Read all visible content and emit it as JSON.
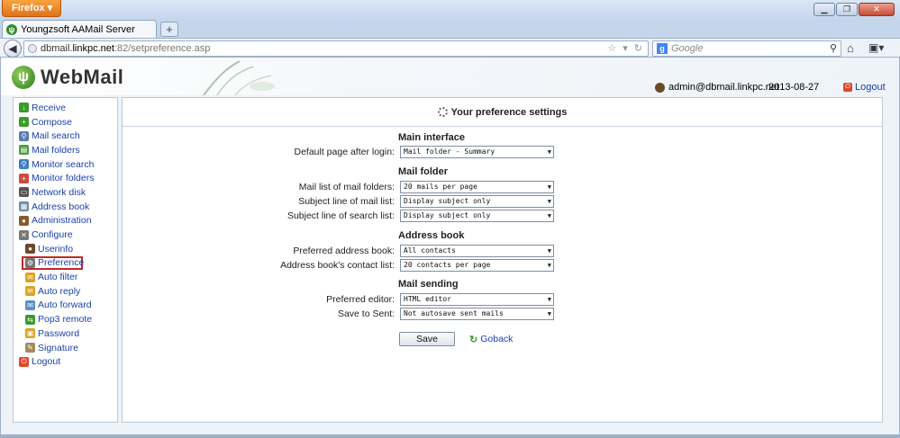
{
  "browser": {
    "menu_label": "Firefox ▾",
    "tab_title": "Youngzsoft AAMail Server",
    "new_tab": "+",
    "url_host_prefix": "dbmail.",
    "url_host_main": "linkpc.net",
    "url_port_path": ":82/setpreference.asp",
    "search_placeholder": "Google",
    "win_minimize": "▁",
    "win_maximize": "❐",
    "win_close": "✕"
  },
  "header": {
    "logo_text": "WebMail",
    "user": "admin@dbmail.linkpc.net",
    "date": "2013-08-27",
    "logout": "Logout"
  },
  "sidebar": {
    "items": [
      {
        "label": "Receive",
        "icon": "receive-icon",
        "color": "#3a9b2a"
      },
      {
        "label": "Compose",
        "icon": "compose-icon",
        "color": "#3a9b2a"
      },
      {
        "label": "Mail search",
        "icon": "search-icon",
        "color": "#5a7fb0"
      },
      {
        "label": "Mail folders",
        "icon": "folders-icon",
        "color": "#4c9a3a"
      },
      {
        "label": "Monitor search",
        "icon": "monitor-search-icon",
        "color": "#3d7fc2"
      },
      {
        "label": "Monitor folders",
        "icon": "monitor-folders-icon",
        "color": "#d04a3a"
      },
      {
        "label": "Network disk",
        "icon": "disk-icon",
        "color": "#555"
      },
      {
        "label": "Address book",
        "icon": "addressbook-icon",
        "color": "#6e8aa6"
      },
      {
        "label": "Administration",
        "icon": "admin-icon",
        "color": "#8a5a2a"
      },
      {
        "label": "Configure",
        "icon": "configure-icon",
        "color": "#777"
      }
    ],
    "sub_items": [
      {
        "label": "Userinfo",
        "icon": "userinfo-icon",
        "color": "#6b4a2a"
      },
      {
        "label": "Preference",
        "icon": "preference-icon",
        "color": "#777"
      },
      {
        "label": "Auto filter",
        "icon": "filter-icon",
        "color": "#d9a323"
      },
      {
        "label": "Auto reply",
        "icon": "reply-icon",
        "color": "#d9a323"
      },
      {
        "label": "Auto forward",
        "icon": "forward-icon",
        "color": "#5a8fc0"
      },
      {
        "label": "Pop3 remote",
        "icon": "pop3-icon",
        "color": "#3a9b2a"
      },
      {
        "label": "Password",
        "icon": "password-icon",
        "color": "#d9a323"
      },
      {
        "label": "Signature",
        "icon": "signature-icon",
        "color": "#a58a5a"
      }
    ],
    "logout": "Logout"
  },
  "main": {
    "title": "Your preference settings",
    "sections": {
      "main_interface": "Main interface",
      "mail_folder": "Mail folder",
      "address_book": "Address book",
      "mail_sending": "Mail sending"
    },
    "fields": {
      "default_page": {
        "label": "Default page after login:",
        "value": "Mail folder - Summary"
      },
      "mail_list": {
        "label": "Mail list of mail folders:",
        "value": "20 mails per page"
      },
      "subject_mail_list": {
        "label": "Subject line of mail list:",
        "value": "Display subject only"
      },
      "subject_search_list": {
        "label": "Subject line of search list:",
        "value": "Display subject only"
      },
      "preferred_address_book": {
        "label": "Preferred address book:",
        "value": "All contacts"
      },
      "contact_list": {
        "label": "Address book's contact list:",
        "value": "20 contacts per page"
      },
      "preferred_editor": {
        "label": "Preferred editor:",
        "value": "HTML editor"
      },
      "save_to_sent": {
        "label": "Save to Sent:",
        "value": "Not autosave sent mails"
      }
    },
    "save_label": "Save",
    "goback_label": "Goback"
  }
}
